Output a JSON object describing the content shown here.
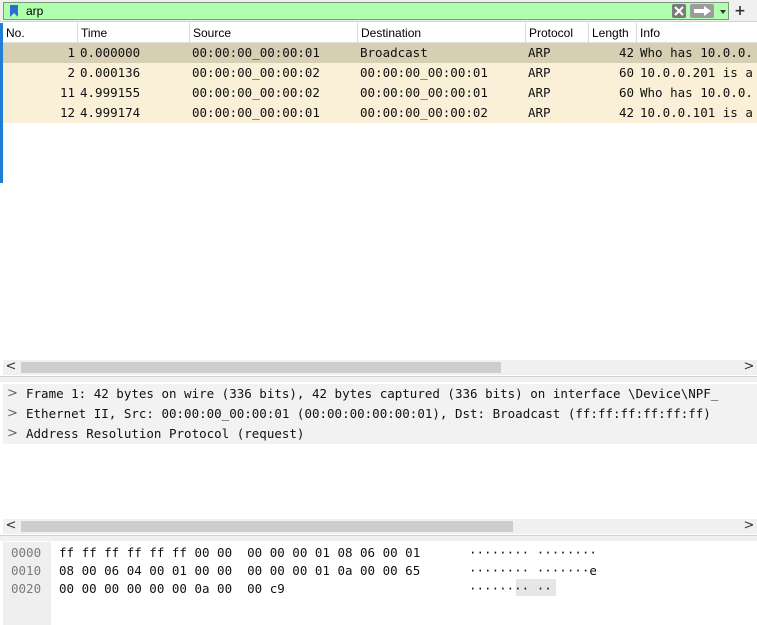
{
  "filter": {
    "value": "arp",
    "plus_label": "+"
  },
  "packet_list": {
    "columns": [
      "No.",
      "Time",
      "Source",
      "Destination",
      "Protocol",
      "Length",
      "Info"
    ],
    "rows": [
      {
        "no": "1",
        "time": "0.000000",
        "source": "00:00:00_00:00:01",
        "destination": "Broadcast",
        "protocol": "ARP",
        "length": "42",
        "info": "Who has 10.0.0.",
        "selected": true
      },
      {
        "no": "2",
        "time": "0.000136",
        "source": "00:00:00_00:00:02",
        "destination": "00:00:00_00:00:01",
        "protocol": "ARP",
        "length": "60",
        "info": "10.0.0.201 is a",
        "selected": false
      },
      {
        "no": "11",
        "time": "4.999155",
        "source": "00:00:00_00:00:02",
        "destination": "00:00:00_00:00:01",
        "protocol": "ARP",
        "length": "60",
        "info": "Who has 10.0.0.",
        "selected": false
      },
      {
        "no": "12",
        "time": "4.999174",
        "source": "00:00:00_00:00:01",
        "destination": "00:00:00_00:00:02",
        "protocol": "ARP",
        "length": "42",
        "info": "10.0.0.101 is a",
        "selected": false
      }
    ]
  },
  "details": {
    "items": [
      {
        "expander": ">",
        "text": "Frame 1: 42 bytes on wire (336 bits), 42 bytes captured (336 bits) on interface \\Device\\NPF_"
      },
      {
        "expander": ">",
        "text": "Ethernet II, Src: 00:00:00_00:00:01 (00:00:00:00:00:01), Dst: Broadcast (ff:ff:ff:ff:ff:ff)"
      },
      {
        "expander": ">",
        "text": "Address Resolution Protocol (request)"
      }
    ]
  },
  "bytes": {
    "rows": [
      {
        "offset": "0000",
        "hex": "ff ff ff ff ff ff 00 00  00 00 00 01 08 06 00 01",
        "ascii": "········ ········"
      },
      {
        "offset": "0010",
        "hex": "08 00 06 04 00 01 00 00  00 00 00 01 0a 00 00 65",
        "ascii": "········ ·······e"
      },
      {
        "offset": "0020",
        "hex": "00 00 00 00 00 00 0a 00  00 c9",
        "ascii": "········ ··"
      }
    ]
  },
  "scroll": {
    "arrow_left": "<",
    "arrow_right": ">"
  },
  "colors": {
    "filter_valid_bg": "#afffaf",
    "row_bg": "#faf0d7",
    "row_selected_bg": "#d7cfb4"
  }
}
